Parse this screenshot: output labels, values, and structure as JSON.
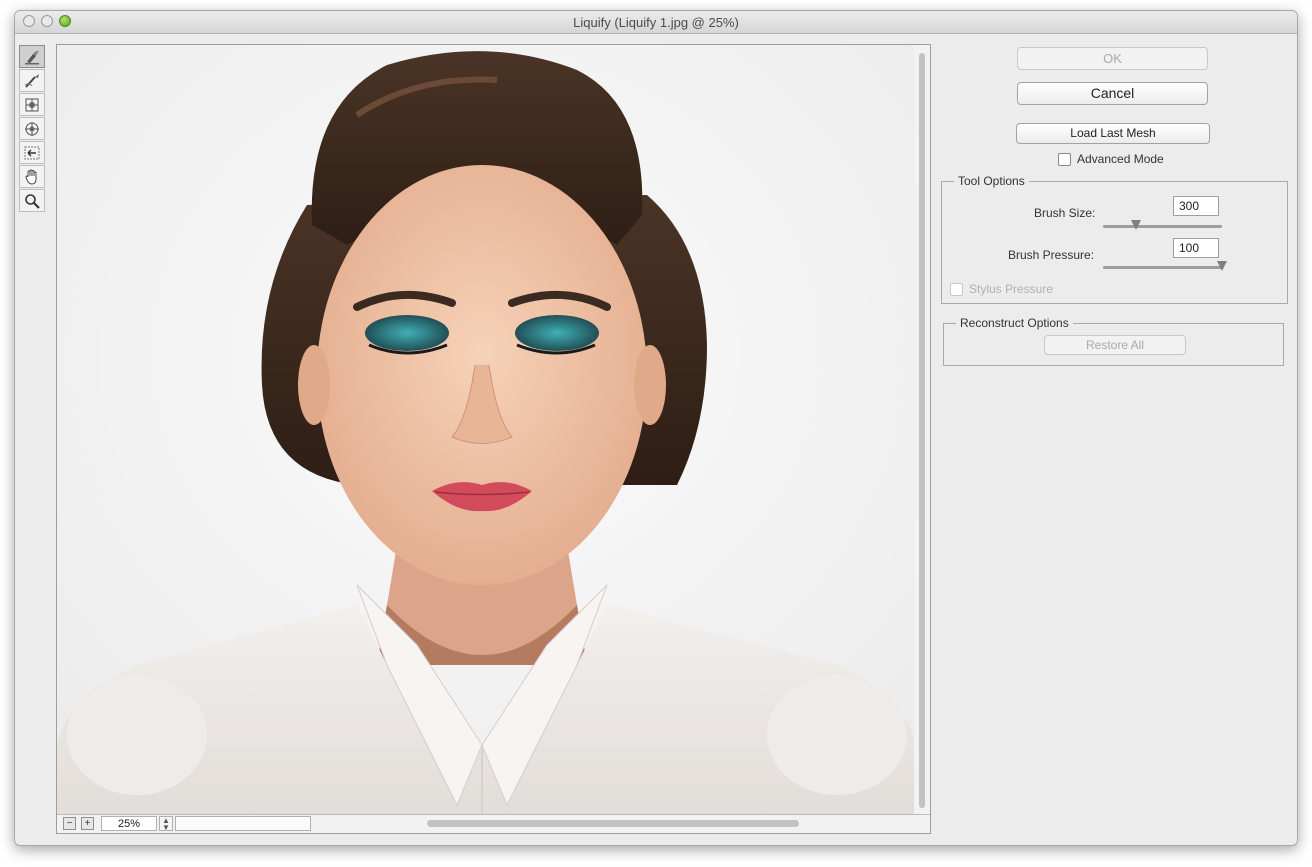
{
  "window": {
    "title": "Liquify (Liquify 1.jpg @ 25%)"
  },
  "tools": [
    {
      "name": "forward-warp-icon"
    },
    {
      "name": "reconstruct-icon"
    },
    {
      "name": "pucker-icon"
    },
    {
      "name": "bloat-icon"
    },
    {
      "name": "push-left-icon"
    },
    {
      "name": "hand-icon"
    },
    {
      "name": "zoom-icon"
    }
  ],
  "buttons": {
    "ok": "OK",
    "cancel": "Cancel",
    "load_last_mesh": "Load Last Mesh",
    "restore_all": "Restore All"
  },
  "advanced_mode": {
    "label": "Advanced Mode",
    "checked": false
  },
  "tool_options": {
    "title": "Tool Options",
    "brush_size": {
      "label": "Brush Size:",
      "value": "300",
      "fraction": 0.28
    },
    "brush_pressure": {
      "label": "Brush Pressure:",
      "value": "100",
      "fraction": 1.0
    },
    "stylus_pressure": {
      "label": "Stylus Pressure",
      "checked": false,
      "enabled": false
    }
  },
  "reconstruct_options": {
    "title": "Reconstruct Options"
  },
  "zoom": {
    "minus": "−",
    "plus": "+",
    "value": "25%"
  }
}
